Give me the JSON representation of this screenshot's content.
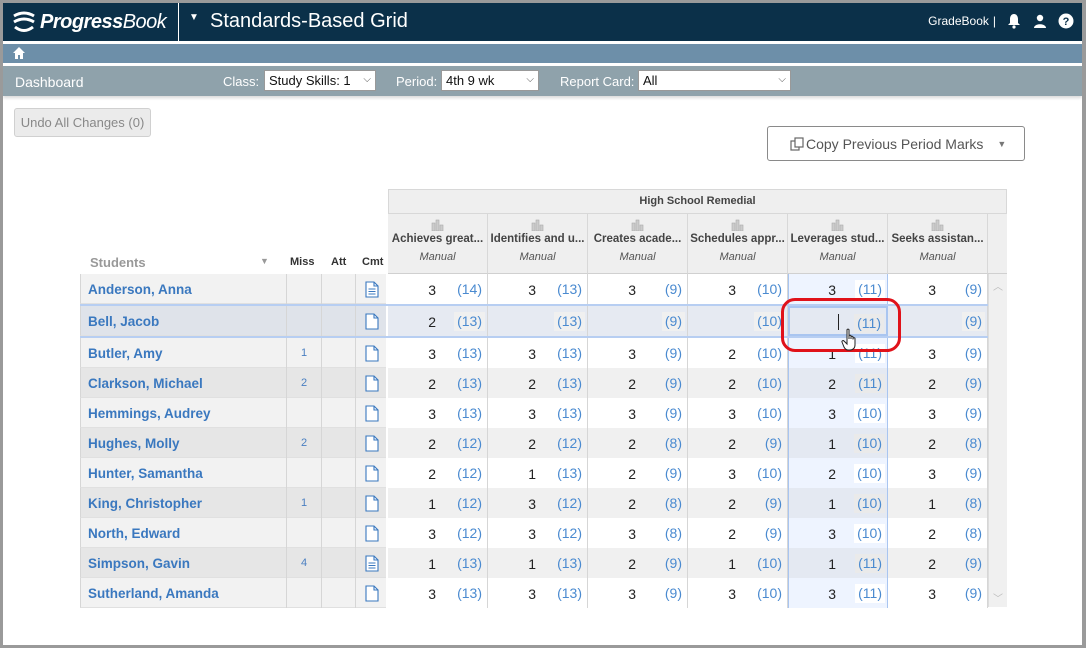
{
  "header": {
    "logo_bold": "Progress",
    "logo_light": "Book",
    "title": "Standards-Based Grid",
    "gradebook_label": "GradeBook",
    "separator": "|",
    "icons": [
      "bell-icon",
      "user-icon",
      "help-icon"
    ]
  },
  "filters": {
    "dashboard_label": "Dashboard",
    "class_label": "Class:",
    "class_value": "Study Skills: 1",
    "period_label": "Period:",
    "period_value": "4th 9 wk",
    "report_card_label": "Report Card:",
    "report_card_value": "All"
  },
  "toolbar": {
    "undo_label": "Undo All Changes (0)",
    "copy_label": "Copy Previous Period Marks"
  },
  "grid": {
    "group_title": "High School Remedial",
    "students_header": "Students",
    "miss_header": "Miss",
    "att_header": "Att",
    "cmt_header": "Cmt",
    "columns": [
      {
        "name": "Achieves great...",
        "type": "Manual"
      },
      {
        "name": "Identifies and u...",
        "type": "Manual"
      },
      {
        "name": "Creates acade...",
        "type": "Manual"
      },
      {
        "name": "Schedules appr...",
        "type": "Manual"
      },
      {
        "name": "Leverages stud...",
        "type": "Manual"
      },
      {
        "name": "Seeks assistan...",
        "type": "Manual"
      }
    ],
    "rows": [
      {
        "name": "Anderson, Anna",
        "miss": "",
        "att": "",
        "comment": "filled",
        "marks": [
          [
            "3",
            "(14)"
          ],
          [
            "3",
            "(13)"
          ],
          [
            "3",
            "(9)"
          ],
          [
            "3",
            "(10)"
          ],
          [
            "3",
            "(11)"
          ],
          [
            "3",
            "(9)"
          ]
        ]
      },
      {
        "name": "Bell, Jacob",
        "miss": "",
        "att": "",
        "comment": "empty",
        "marks": [
          [
            "2",
            "(13)"
          ],
          [
            "",
            "(13)"
          ],
          [
            "",
            "(9)"
          ],
          [
            "",
            "(10)"
          ],
          [
            "",
            "(11)"
          ],
          [
            "",
            "(9)"
          ]
        ]
      },
      {
        "name": "Butler, Amy",
        "miss": "1",
        "att": "",
        "comment": "empty",
        "marks": [
          [
            "3",
            "(13)"
          ],
          [
            "3",
            "(13)"
          ],
          [
            "3",
            "(9)"
          ],
          [
            "2",
            "(10)"
          ],
          [
            "1",
            "(11)"
          ],
          [
            "3",
            "(9)"
          ]
        ]
      },
      {
        "name": "Clarkson, Michael",
        "miss": "2",
        "att": "",
        "comment": "empty",
        "marks": [
          [
            "2",
            "(13)"
          ],
          [
            "2",
            "(13)"
          ],
          [
            "2",
            "(9)"
          ],
          [
            "2",
            "(10)"
          ],
          [
            "2",
            "(11)"
          ],
          [
            "2",
            "(9)"
          ]
        ]
      },
      {
        "name": "Hemmings, Audrey",
        "miss": "",
        "att": "",
        "comment": "empty",
        "marks": [
          [
            "3",
            "(13)"
          ],
          [
            "3",
            "(13)"
          ],
          [
            "3",
            "(9)"
          ],
          [
            "3",
            "(10)"
          ],
          [
            "3",
            "(10)"
          ],
          [
            "3",
            "(9)"
          ]
        ]
      },
      {
        "name": "Hughes, Molly",
        "miss": "2",
        "att": "",
        "comment": "empty",
        "marks": [
          [
            "2",
            "(12)"
          ],
          [
            "2",
            "(12)"
          ],
          [
            "2",
            "(8)"
          ],
          [
            "2",
            "(9)"
          ],
          [
            "1",
            "(10)"
          ],
          [
            "2",
            "(8)"
          ]
        ]
      },
      {
        "name": "Hunter, Samantha",
        "miss": "",
        "att": "",
        "comment": "empty",
        "marks": [
          [
            "2",
            "(12)"
          ],
          [
            "1",
            "(13)"
          ],
          [
            "2",
            "(9)"
          ],
          [
            "3",
            "(10)"
          ],
          [
            "2",
            "(10)"
          ],
          [
            "3",
            "(9)"
          ]
        ]
      },
      {
        "name": "King, Christopher",
        "miss": "1",
        "att": "",
        "comment": "empty",
        "marks": [
          [
            "1",
            "(12)"
          ],
          [
            "3",
            "(12)"
          ],
          [
            "2",
            "(8)"
          ],
          [
            "2",
            "(9)"
          ],
          [
            "1",
            "(10)"
          ],
          [
            "1",
            "(8)"
          ]
        ]
      },
      {
        "name": "North, Edward",
        "miss": "",
        "att": "",
        "comment": "empty",
        "marks": [
          [
            "3",
            "(12)"
          ],
          [
            "3",
            "(12)"
          ],
          [
            "3",
            "(8)"
          ],
          [
            "2",
            "(9)"
          ],
          [
            "3",
            "(10)"
          ],
          [
            "2",
            "(8)"
          ]
        ]
      },
      {
        "name": "Simpson, Gavin",
        "miss": "4",
        "att": "",
        "comment": "filled",
        "marks": [
          [
            "1",
            "(13)"
          ],
          [
            "1",
            "(13)"
          ],
          [
            "2",
            "(9)"
          ],
          [
            "1",
            "(10)"
          ],
          [
            "1",
            "(11)"
          ],
          [
            "2",
            "(9)"
          ]
        ]
      },
      {
        "name": "Sutherland, Amanda",
        "miss": "",
        "att": "",
        "comment": "empty",
        "marks": [
          [
            "3",
            "(13)"
          ],
          [
            "3",
            "(13)"
          ],
          [
            "3",
            "(9)"
          ],
          [
            "3",
            "(10)"
          ],
          [
            "3",
            "(11)"
          ],
          [
            "3",
            "(9)"
          ]
        ]
      }
    ],
    "selected_row": 1,
    "highlighted_column": 4
  }
}
